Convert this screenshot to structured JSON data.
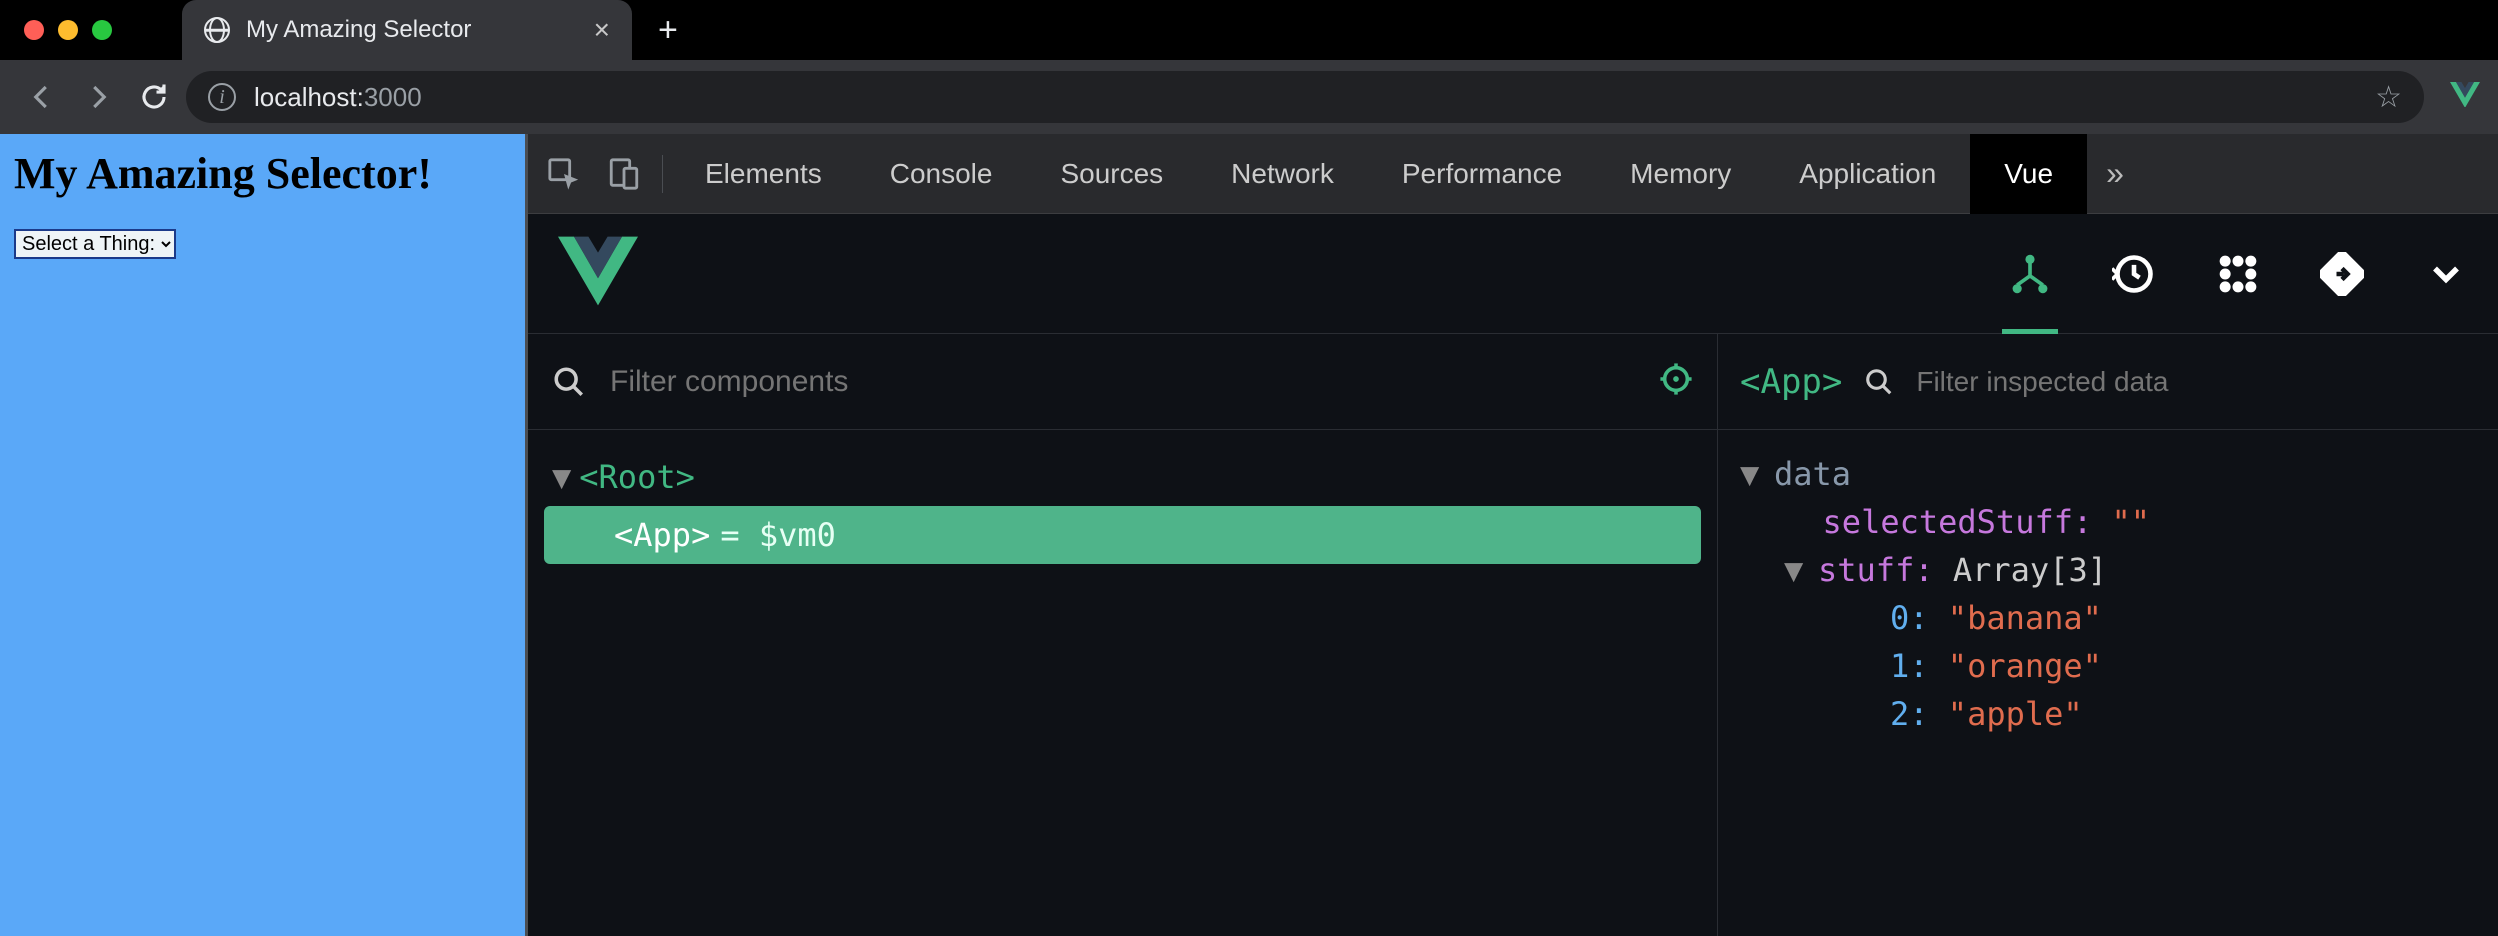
{
  "browser": {
    "tab_title": "My Amazing Selector",
    "close_glyph": "×",
    "newtab_glyph": "+",
    "url_host": "localhost:",
    "url_port": "3000",
    "star_glyph": "☆"
  },
  "page": {
    "heading": "My Amazing Selector!",
    "select_value": "Select a Thing:"
  },
  "devtools": {
    "tabs": [
      "Elements",
      "Console",
      "Sources",
      "Network",
      "Performance",
      "Memory",
      "Application",
      "Vue"
    ],
    "active_tab": "Vue",
    "more_glyph": "»"
  },
  "vue": {
    "filter_components_placeholder": "Filter components",
    "filter_inspected_placeholder": "Filter inspected data",
    "tree": {
      "root_label": "<Root>",
      "app_label": "<App>",
      "app_suffix": " = $vm0"
    },
    "inspector": {
      "selected_component": "<App>",
      "section_label": "data",
      "data": {
        "selectedStuff_key": "selectedStuff:",
        "selectedStuff_value": "\"\"",
        "stuff_key": "stuff:",
        "stuff_type": "Array[3]",
        "items": [
          {
            "index": "0:",
            "value": "\"banana\""
          },
          {
            "index": "1:",
            "value": "\"orange\""
          },
          {
            "index": "2:",
            "value": "\"apple\""
          }
        ]
      }
    }
  }
}
